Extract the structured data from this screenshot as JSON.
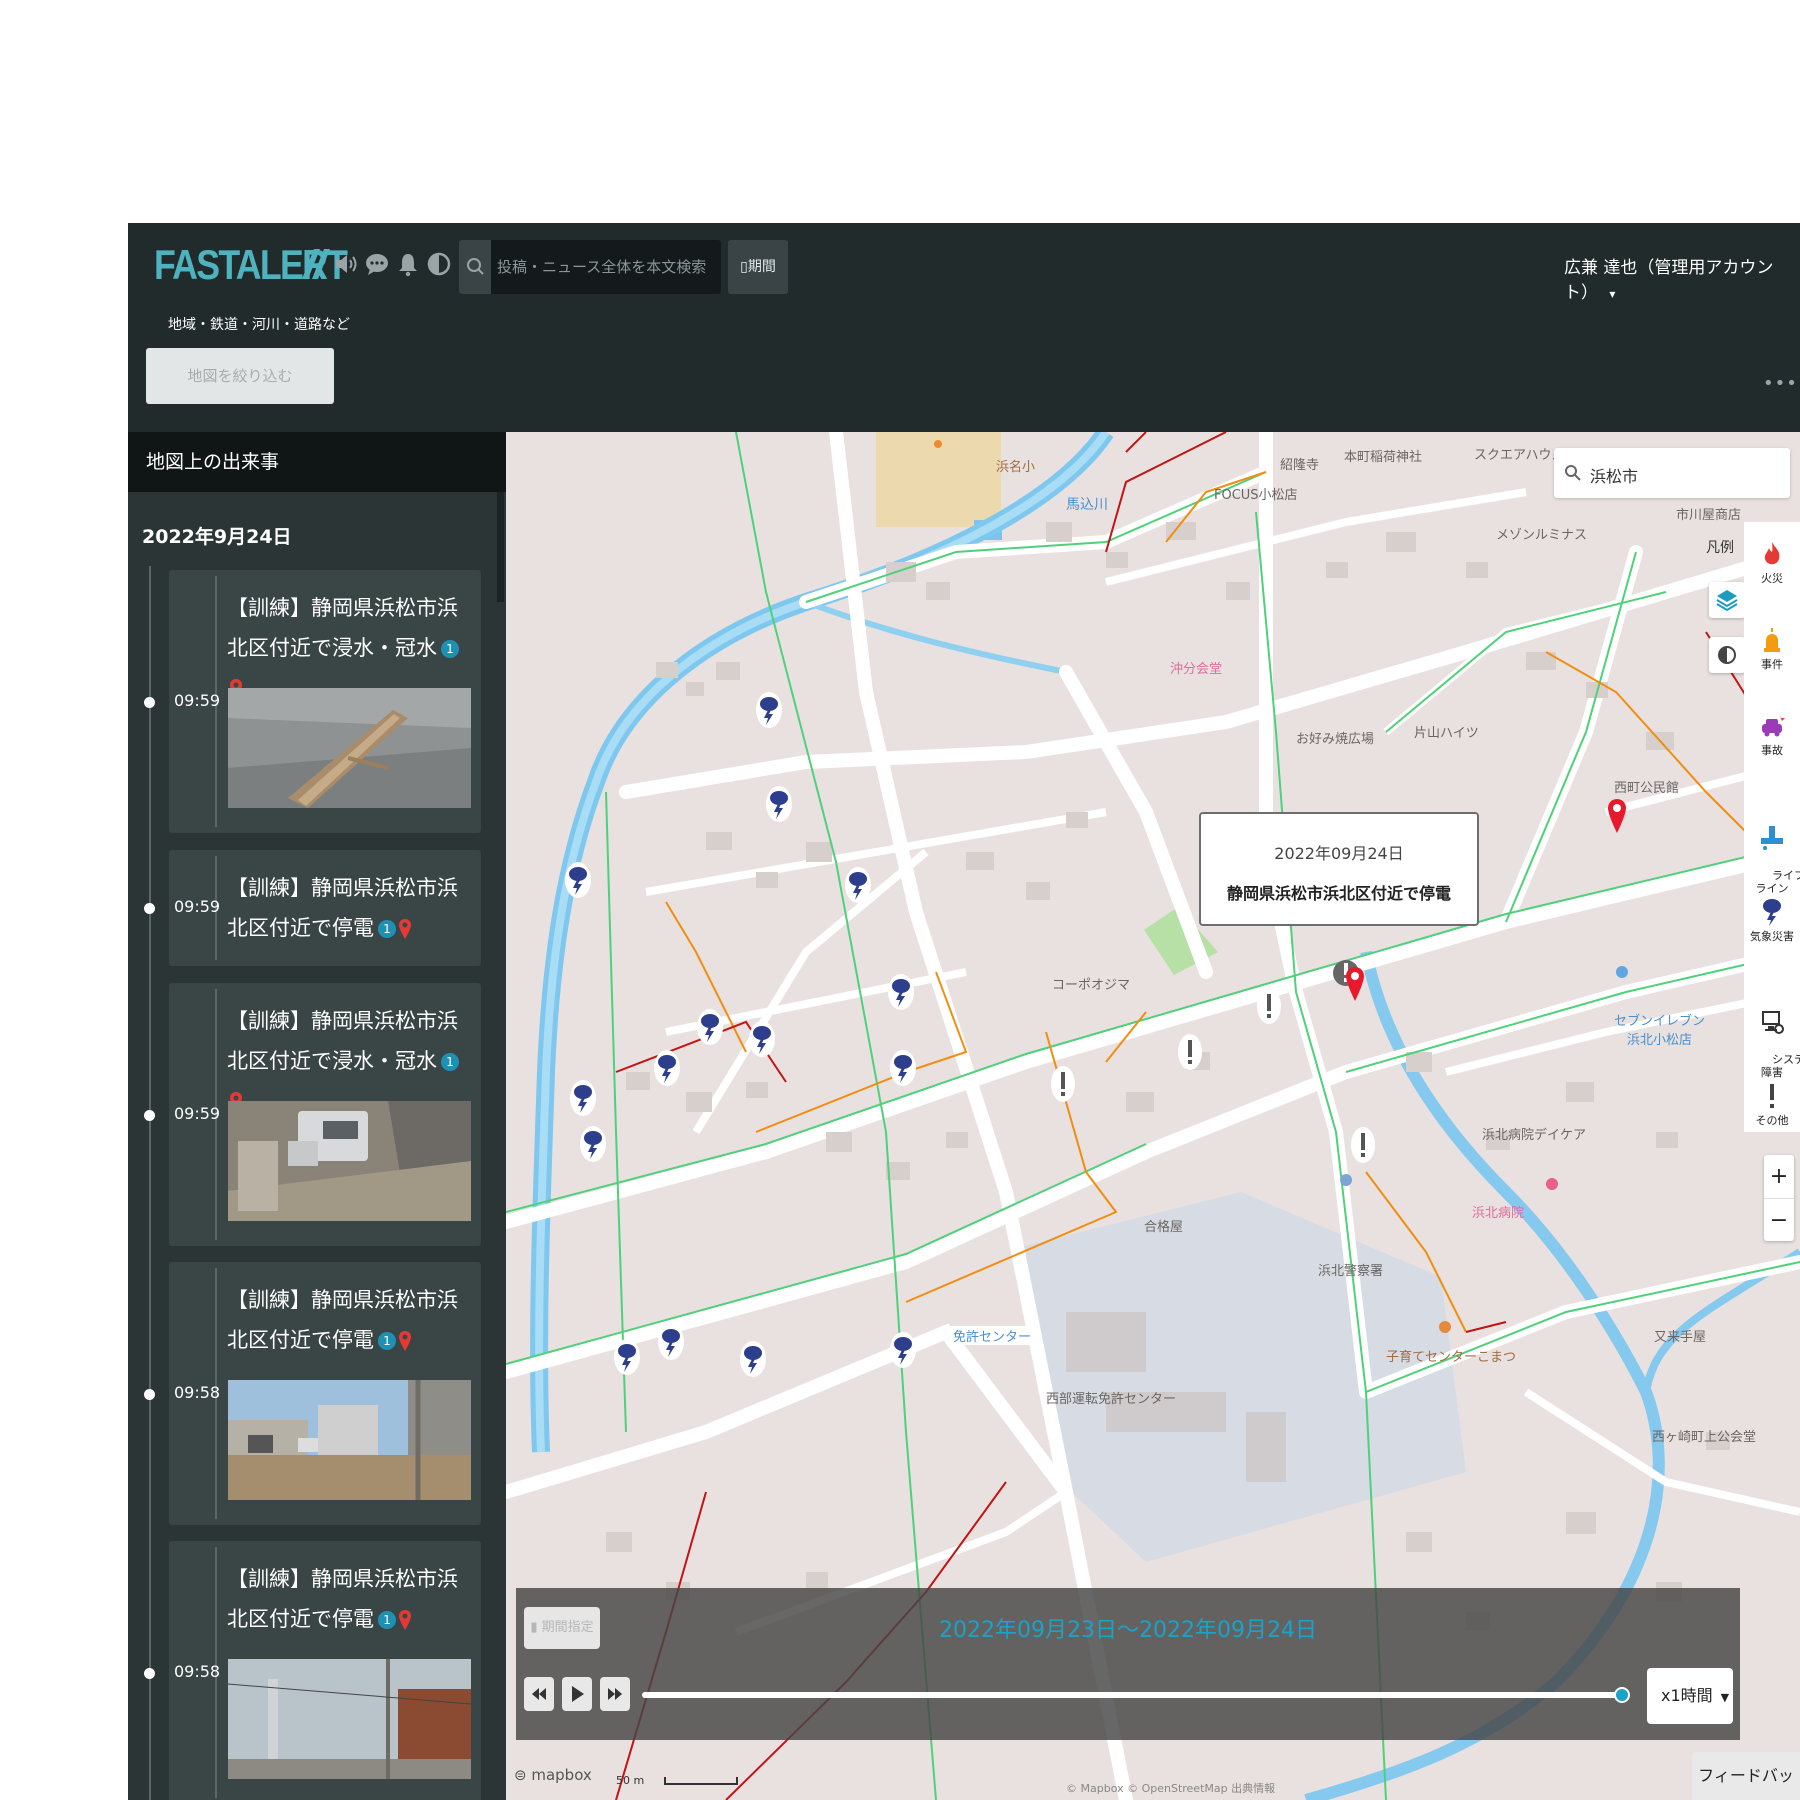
{
  "app": {
    "logo": "FASTALERT",
    "search_placeholder": "投稿・ニュース全体を本文検索",
    "period_button": "期間",
    "user_name": "広兼 達也（管理用アカウント）",
    "user_caret": "▾",
    "region_label": "地域・鉄道・河川・道路など",
    "filter_button": "地図を絞り込む",
    "more": "•••"
  },
  "sidebar": {
    "header": "地図上の出来事",
    "date": "2022年9月24日",
    "events": [
      {
        "time": "09:59",
        "title": "【訓練】静岡県浜松市浜北区付近で浸水・冠水",
        "count": "1",
        "photo": "driftwood"
      },
      {
        "time": "09:59",
        "title": "【訓練】静岡県浜松市浜北区付近で停電",
        "count": "1",
        "photo": ""
      },
      {
        "time": "09:59",
        "title": "【訓練】静岡県浜松市浜北区付近で浸水・冠水",
        "count": "1",
        "photo": "car"
      },
      {
        "time": "09:58",
        "title": "【訓練】静岡県浜松市浜北区付近で停電",
        "count": "1",
        "photo": "street"
      },
      {
        "time": "09:58",
        "title": "【訓練】静岡県浜松市浜北区付近で停電",
        "count": "1",
        "photo": "poles"
      }
    ]
  },
  "map": {
    "search_value": "浜松市",
    "legend_label": "凡例",
    "categories": [
      {
        "label": "火災",
        "icon": "fire-icon",
        "color": "#e53935"
      },
      {
        "label": "事件",
        "icon": "siren-icon",
        "color": "#f39c12"
      },
      {
        "label": "事故",
        "icon": "car-crash-icon",
        "color": "#9b3bb8"
      },
      {
        "label": "ライフ\nライン",
        "icon": "pipe-icon",
        "color": "#2d8fd5"
      },
      {
        "label": "気象災害",
        "icon": "storm-icon",
        "color": "#2c3e8c"
      },
      {
        "label": "システム\n障害",
        "icon": "system-icon",
        "color": "#333333"
      },
      {
        "label": "その他",
        "icon": "exclamation-icon",
        "color": "#444444"
      }
    ],
    "popup": {
      "date": "2022年09月24日",
      "title": "静岡県浜松市浜北区付近で停電"
    },
    "labels": [
      {
        "text": "浜名小",
        "cls": "brown"
      },
      {
        "text": "馬込川",
        "cls": "blue big"
      },
      {
        "text": "紹隆寺",
        "cls": ""
      },
      {
        "text": "本町稲荷神社",
        "cls": ""
      },
      {
        "text": "FOCUS小松店",
        "cls": ""
      },
      {
        "text": "スクエアハウス",
        "cls": ""
      },
      {
        "text": "市川屋商店",
        "cls": ""
      },
      {
        "text": "メゾンルミナス",
        "cls": ""
      },
      {
        "text": "沖分会堂",
        "cls": "pink"
      },
      {
        "text": "お好み焼広場",
        "cls": ""
      },
      {
        "text": "片山ハイツ",
        "cls": ""
      },
      {
        "text": "西町公民館",
        "cls": ""
      },
      {
        "text": "コーポオジマ",
        "cls": ""
      },
      {
        "text": "セブンイレブン\n浜北小松店",
        "cls": "blue"
      },
      {
        "text": "浜北病院デイケア",
        "cls": ""
      },
      {
        "text": "浜北病院",
        "cls": "pink"
      },
      {
        "text": "合格屋",
        "cls": ""
      },
      {
        "text": "浜北警察署",
        "cls": ""
      },
      {
        "text": "免許センター",
        "cls": "blue"
      },
      {
        "text": "子育てセンターこまつ",
        "cls": "brown"
      },
      {
        "text": "又来手屋",
        "cls": ""
      },
      {
        "text": "西部運転免許センター",
        "cls": ""
      },
      {
        "text": "西ヶ崎町上公会堂",
        "cls": ""
      }
    ],
    "playback": {
      "period_button": "期間指定",
      "range": "2022年09月23日～2022年09月24日",
      "progress": 1.0,
      "speed": "x1時間"
    },
    "feedback": "フィードバック",
    "attribution": "mapbox",
    "scale": "50 m",
    "copyright": "© Mapbox © OpenStreetMap 出典情報"
  }
}
